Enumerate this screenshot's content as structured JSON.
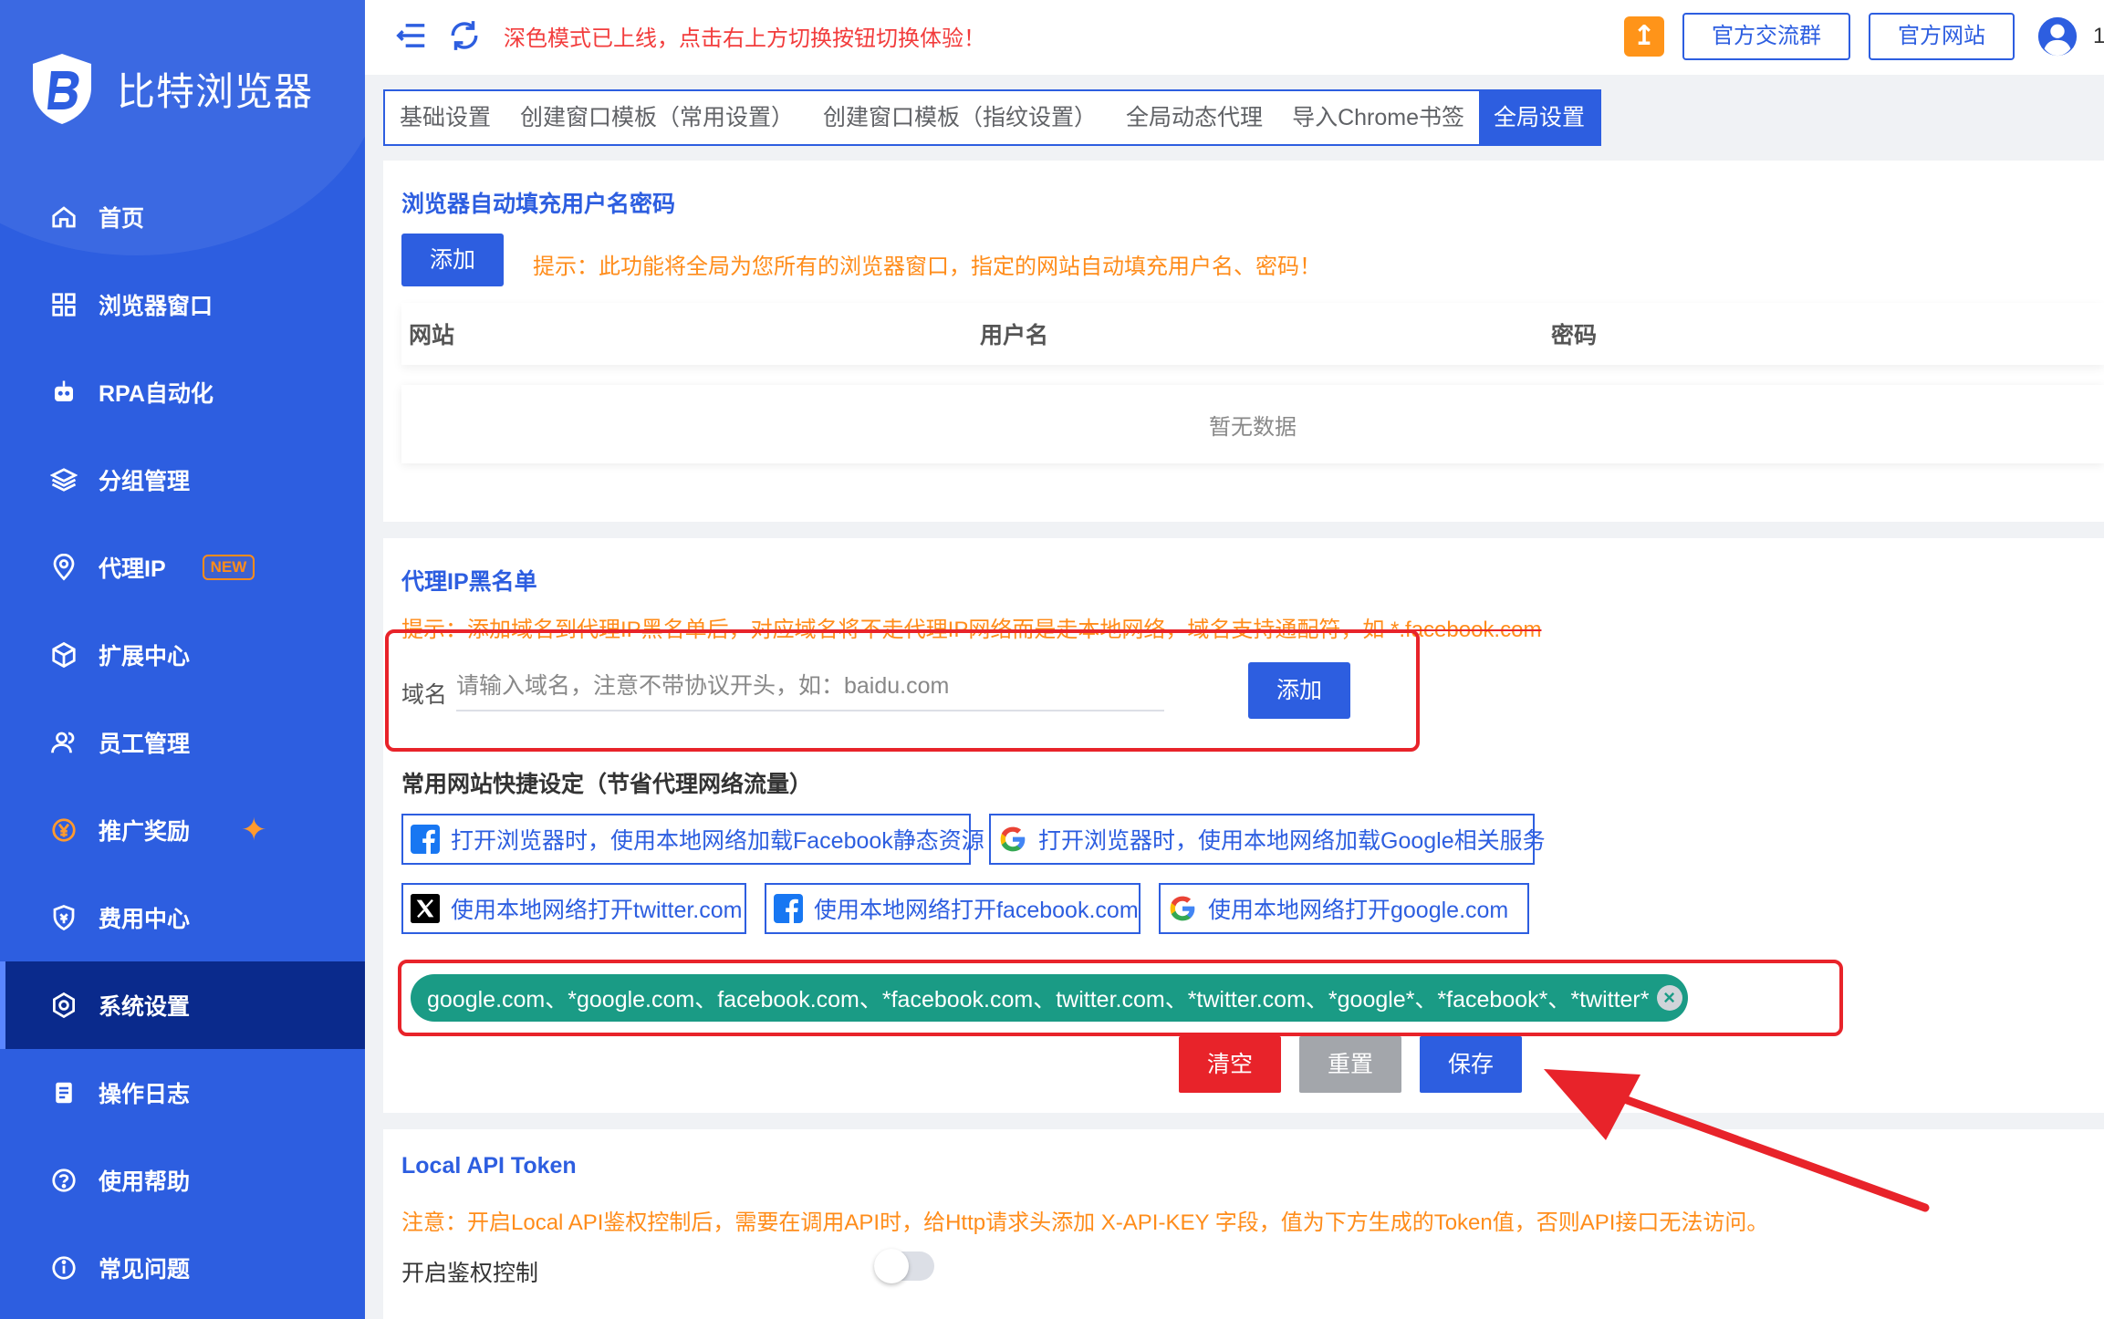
{
  "sidebar": {
    "brand_name": "比特浏览器",
    "items": [
      {
        "label": "首页",
        "icon": "home-icon"
      },
      {
        "label": "浏览器窗口",
        "icon": "grid-icon"
      },
      {
        "label": "RPA自动化",
        "icon": "robot-icon"
      },
      {
        "label": "分组管理",
        "icon": "layers-icon"
      },
      {
        "label": "代理IP",
        "icon": "location-pin-icon",
        "badge": "NEW"
      },
      {
        "label": "扩展中心",
        "icon": "cube-icon"
      },
      {
        "label": "员工管理",
        "icon": "users-icon"
      },
      {
        "label": "推广奖励",
        "icon": "yuan-coin-icon",
        "extra_icon": "sparkle-icon"
      },
      {
        "label": "费用中心",
        "icon": "shield-icon"
      },
      {
        "label": "系统设置",
        "icon": "settings-icon",
        "active": true
      },
      {
        "label": "操作日志",
        "icon": "log-icon"
      },
      {
        "label": "使用帮助",
        "icon": "help-icon"
      },
      {
        "label": "常见问题",
        "icon": "info-icon"
      }
    ]
  },
  "topbar": {
    "notice": "深色模式已上线，点击右上方切换按钮切换体验！",
    "group_btn": "官方交流群",
    "site_btn": "官方网站",
    "trailing_text": "1"
  },
  "tabs": [
    {
      "label": "基础设置"
    },
    {
      "label": "创建窗口模板（常用设置）"
    },
    {
      "label": "创建窗口模板（指纹设置）"
    },
    {
      "label": "全局动态代理"
    },
    {
      "label": "导入Chrome书签"
    },
    {
      "label": "全局设置",
      "active": true
    }
  ],
  "autofill": {
    "title": "浏览器自动填充用户名密码",
    "add_btn": "添加",
    "hint": "提示：此功能将全局为您所有的浏览器窗口，指定的网站自动填充用户名、密码！",
    "columns": [
      "网站",
      "用户名",
      "密码"
    ],
    "empty_text": "暂无数据"
  },
  "blacklist": {
    "title": "代理IP黑名单",
    "hint": "提示：添加域名到代理IP黑名单后，对应域名将不走代理IP网络而是走本地网络，域名支持通配符，如 *.facebook.com",
    "domain_label": "域名",
    "domain_placeholder": "请输入域名，注意不带协议开头，如：baidu.com",
    "add_btn": "添加",
    "quick_title": "常用网站快捷设定（节省代理网络流量）",
    "quick_buttons": [
      {
        "label": "打开浏览器时，使用本地网络加载Facebook静态资源",
        "icon": "facebook-icon"
      },
      {
        "label": "打开浏览器时，使用本地网络加载Google相关服务",
        "icon": "google-icon"
      },
      {
        "label": "使用本地网络打开twitter.com",
        "icon": "x-twitter-icon"
      },
      {
        "label": "使用本地网络打开facebook.com",
        "icon": "facebook-icon"
      },
      {
        "label": "使用本地网络打开google.com",
        "icon": "google-icon"
      }
    ],
    "domains_tag": "google.com、*google.com、facebook.com、*facebook.com、twitter.com、*twitter.com、*google*、*facebook*、*twitter*",
    "clear_btn": "清空",
    "reset_btn": "重置",
    "save_btn": "保存"
  },
  "api_token": {
    "title": "Local API Token",
    "note": "注意：开启Local API鉴权控制后，需要在调用API时，给Http请求头添加 X-API-KEY 字段，值为下方生成的Token值，否则API接口无法访问。",
    "toggle_label": "开启鉴权控制",
    "toggle_on": false
  },
  "colors": {
    "primary": "#2d5ee0",
    "sidebar_active": "#0a2a8c",
    "warning": "#ff8c1a",
    "danger": "#e8232a",
    "tag_green": "#1a9b85"
  }
}
